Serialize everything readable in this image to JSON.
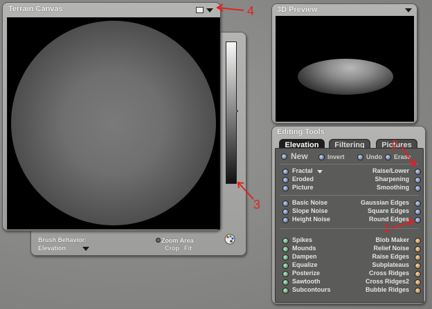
{
  "terrain_canvas": {
    "title": "Terrain Canvas",
    "brush_behavior_label": "Brush Behavior:",
    "brush_behavior_value": "Elevation",
    "zoom_area_label": "Zoom Area",
    "crop_label": "Crop",
    "fit_label": "Fit"
  },
  "preview": {
    "title": "3D Preview"
  },
  "editing_tools": {
    "title": "Editing Tools",
    "tabs": [
      {
        "label": "Elevation"
      },
      {
        "label": "Filtering"
      },
      {
        "label": "Pictures"
      }
    ],
    "top_buttons": {
      "new": "New",
      "invert": "Invert",
      "undo": "Undo",
      "erase": "Erase"
    },
    "left_group1": [
      "Fractal",
      "Eroded",
      "Picture"
    ],
    "right_group1": [
      "Raise/Lower",
      "Sharpening",
      "Smoothing"
    ],
    "left_group2": [
      "Basic Noise",
      "Slope Noise",
      "Height Noise"
    ],
    "right_group2": [
      "Gaussian Edges",
      "Square Edges",
      "Round Edges"
    ],
    "left_group3": [
      "Spikes",
      "Mounds",
      "Dampen",
      "Equalize",
      "Posterize",
      "Sawtooth",
      "Subcontours"
    ],
    "right_group3": [
      "Blob Maker",
      "Relief Noise",
      "Raise Edges",
      "Subplateaus",
      "Cross Ridges",
      "Cross Ridges2",
      "Bubble Ridges"
    ]
  },
  "annotations": {
    "n1": "1",
    "n2": "2",
    "n3": "3",
    "n4": "4"
  },
  "colors": {
    "annotation": "#e32020",
    "panel": "#a9a9a7",
    "canvas_bg": "#000000"
  }
}
